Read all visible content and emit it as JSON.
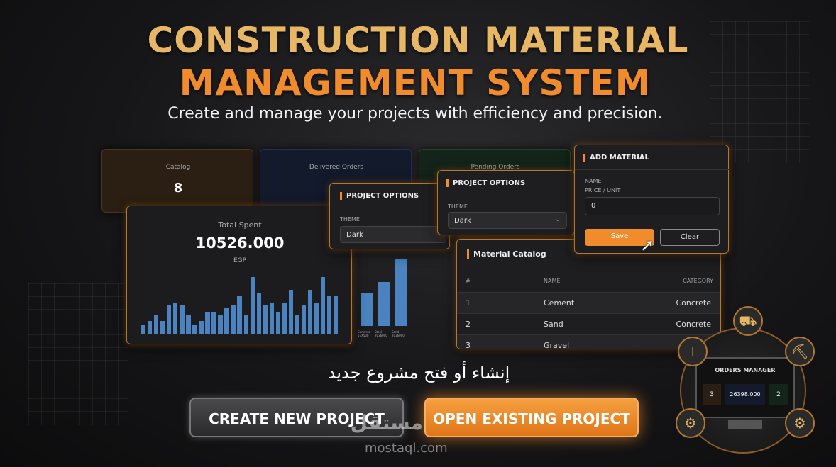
{
  "header": {
    "title_line1": "CONSTRUCTION MATERIAL",
    "title_line2": "MANAGEMENT SYSTEM",
    "subtitle": "Create and manage your projects with efficiency and precision."
  },
  "stat_cards": {
    "catalog": {
      "label": "Catalog",
      "value": "8"
    },
    "delivered": {
      "label": "Delivered Orders"
    },
    "pending": {
      "label": "Pending Orders"
    }
  },
  "total_spent": {
    "label": "Total Spent",
    "value": "10526.000",
    "unit": "EGP"
  },
  "bar_values": [
    3,
    4,
    6,
    4,
    9,
    10,
    9,
    6,
    3,
    4,
    7,
    7,
    6,
    8,
    9,
    12,
    6,
    18,
    13,
    9,
    10,
    7,
    10,
    14,
    6,
    9,
    14,
    10,
    18,
    12,
    12
  ],
  "mini_chart": {
    "values": [
      20,
      26,
      40
    ],
    "labels": [
      "Concrete\n57X500",
      "Steel\n2036000",
      "Sand\n2036000"
    ]
  },
  "project_options_1": {
    "header": "PROJECT OPTIONS",
    "theme_label": "THEME",
    "theme_value": "Dark"
  },
  "project_options_2": {
    "header": "PROJECT OPTIONS",
    "theme_label": "THEME",
    "theme_value": "Dark"
  },
  "add_material": {
    "header": "ADD MATERIAL",
    "name_label": "NAME",
    "price_label": "PRICE / UNIT",
    "price_value": "0",
    "save": "Save",
    "clear": "Clear"
  },
  "catalog_table": {
    "title": "Material Catalog",
    "columns": [
      "#",
      "NAME",
      "CATEGORY"
    ],
    "rows": [
      [
        "1",
        "Cement",
        "Concrete"
      ],
      [
        "2",
        "Sand",
        "Concrete"
      ],
      [
        "3",
        "Gravel",
        ""
      ]
    ]
  },
  "arabic_caption": "إنشاء أو فتح مشروع جديد",
  "buttons": {
    "create": "CREATE NEW PROJECT",
    "open": "OPEN EXISTING PROJECT"
  },
  "orders_manager": {
    "title": "ORDERS MANAGER",
    "left": "3",
    "middle": "26398.000",
    "right": "2"
  },
  "watermark": {
    "arabic": "مستقل",
    "latin": "mostaql.com"
  },
  "colors": {
    "accent": "#f08c2c",
    "gold": "#e7b765",
    "bar": "#4a83c0"
  }
}
